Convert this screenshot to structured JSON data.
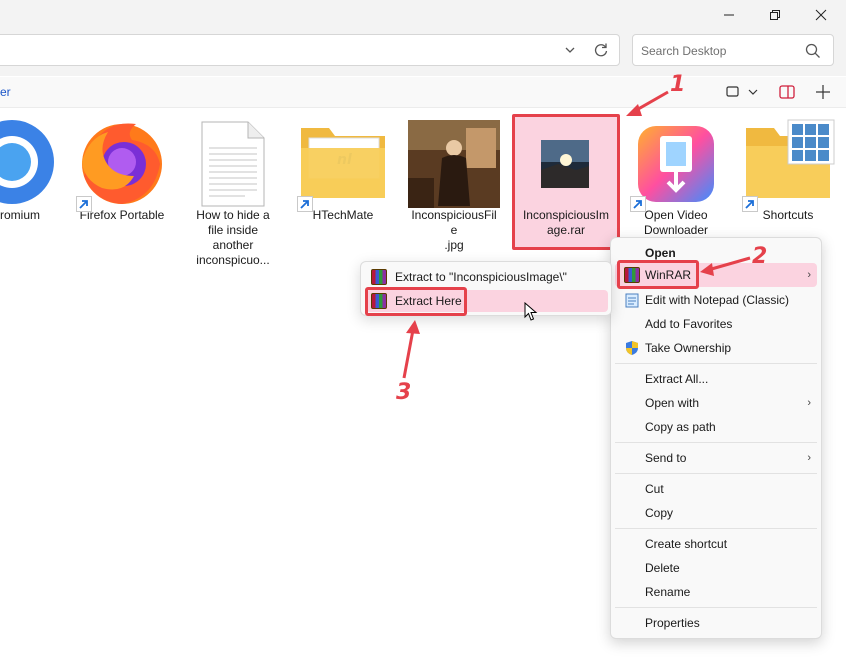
{
  "window": {
    "minimize": "—",
    "maximize": "❐",
    "close": "✕"
  },
  "address": {
    "search_placeholder": "Search Desktop"
  },
  "commandbar": {
    "left_fragment": "er"
  },
  "desktop_items": [
    {
      "label": "romium",
      "icon": "chromium-icon",
      "shortcut": false
    },
    {
      "label": "Firefox Portable",
      "icon": "firefox-icon",
      "shortcut": true
    },
    {
      "label": "How to hide a file inside another inconspicuo...",
      "icon": "document-icon",
      "shortcut": false
    },
    {
      "label": "HTechMate",
      "icon": "folder-icon",
      "shortcut": true
    },
    {
      "label": "InconspiciousFile.jpg",
      "icon": "photo-thumbnail",
      "shortcut": false
    },
    {
      "label": "InconspiciousImage.rar",
      "icon": "rar-thumbnail",
      "shortcut": false
    },
    {
      "label": "Open Video Downloader",
      "icon": "video-downloader-icon",
      "shortcut": true
    },
    {
      "label": "Shortcuts",
      "icon": "folder-icon",
      "shortcut": true
    }
  ],
  "labels": {
    "item0": "romium",
    "item1": "Firefox Portable",
    "item2a": "How to hide a",
    "item2b": "file inside",
    "item2c": "another",
    "item2d": "inconspicuo...",
    "item3": "HTechMate",
    "item4a": "InconspiciousFile",
    "item4b": ".jpg",
    "item5a": "InconspiciousIm",
    "item5b": "age.rar",
    "item6a": "Open Video",
    "item6b": "Downloader",
    "item7": "Shortcuts"
  },
  "context_menu": {
    "open": "Open",
    "winrar": "WinRAR",
    "edit_notepad": "Edit with Notepad (Classic)",
    "add_favorites": "Add to Favorites",
    "take_ownership": "Take Ownership",
    "extract_all": "Extract All...",
    "open_with": "Open with",
    "copy_as_path": "Copy as path",
    "send_to": "Send to",
    "cut": "Cut",
    "copy": "Copy",
    "create_shortcut": "Create shortcut",
    "delete": "Delete",
    "rename": "Rename",
    "properties": "Properties"
  },
  "submenu": {
    "extract_to": "Extract to \"InconspiciousImage\\\"",
    "extract_here": "Extract Here"
  },
  "callouts": {
    "one": "1",
    "two": "2",
    "three": "3"
  },
  "colors": {
    "highlight": "#fbd3e0",
    "annotation_red": "#e5414b"
  }
}
